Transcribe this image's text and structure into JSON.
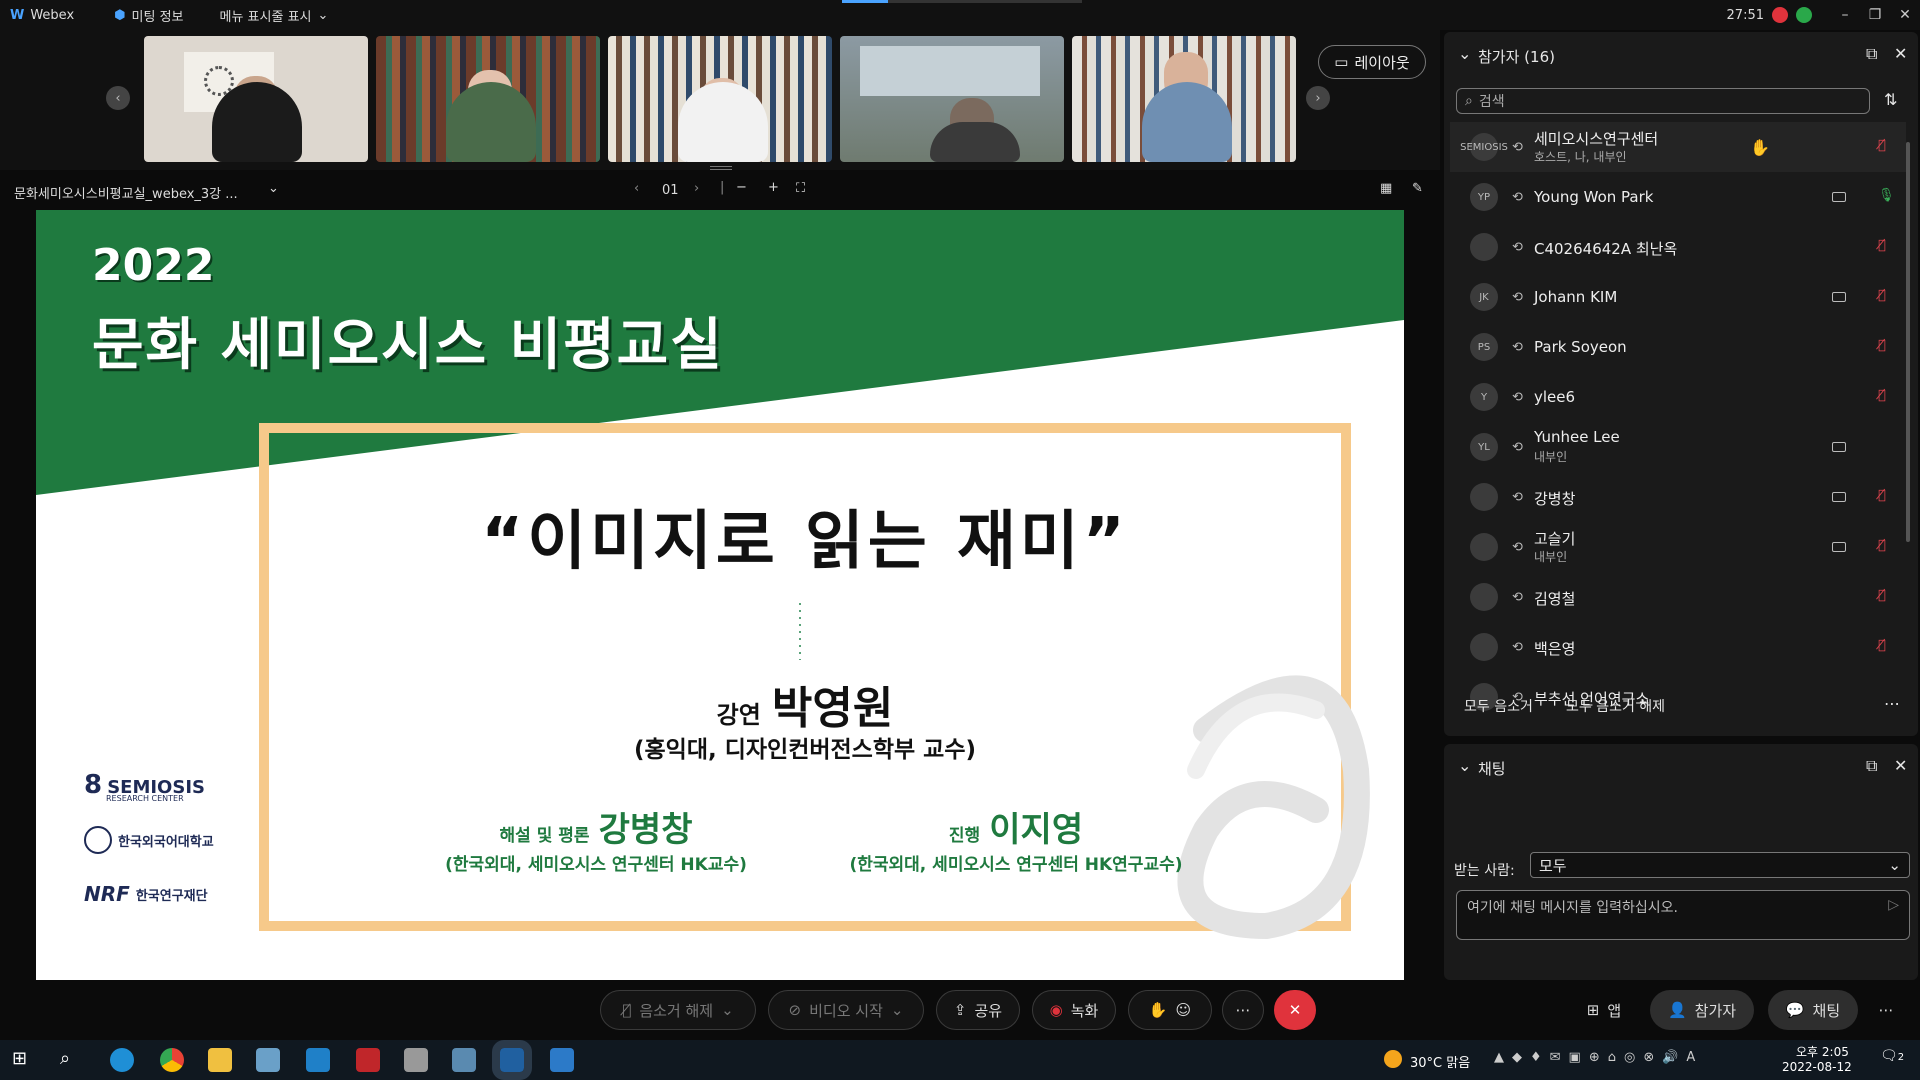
{
  "titlebar": {
    "app_name": "Webex",
    "meeting_info": "미팅 정보",
    "menu_toggle": "메뉴 표시줄 표시",
    "timer": "27:51"
  },
  "layout_button": "레이아웃",
  "share": {
    "filename": "문화세미오시스비평교실_webex_3강 ...",
    "page": "01"
  },
  "slide": {
    "year": "2022",
    "title": "문화 세미오시스 비평교실",
    "quote": "“이미지로 읽는 재미”",
    "lecture_label": "강연",
    "lecturer": "박영원",
    "lecturer_affil": "(홍익대, 디자인컨버전스학부 교수)",
    "commentary_label": "해설 및 평론",
    "commentator": "강병창",
    "commentator_affil": "(한국외대, 세미오시스 연구센터 HK교수)",
    "host_label": "진행",
    "host": "이지영",
    "host_affil": "(한국외대, 세미오시스 연구센터 HK연구교수)",
    "logos": {
      "semiosis": "SEMIOSIS",
      "semiosis_sub": "RESEARCH CENTER",
      "hufs": "한국외국어대학교",
      "nrf_mark": "NRF",
      "nrf": "한국연구재단"
    }
  },
  "controls": {
    "unmute": "음소거 해제",
    "start_video": "비디오 시작",
    "share": "공유",
    "record": "녹화",
    "apps": "앱",
    "participants": "참가자",
    "chat": "채팅"
  },
  "participants_panel": {
    "title": "참가자 (16)",
    "search_placeholder": "검색",
    "mute_all": "모두 음소거",
    "unmute_all": "모두 음소거 해제",
    "rows": [
      {
        "initials": "SEMIOSIS",
        "name": "세미오시스연구센터",
        "sub": "호스트, 나, 내부인",
        "icon": "hand",
        "mic": "muted"
      },
      {
        "initials": "YP",
        "name": "Young Won Park",
        "sub": "",
        "icon": "camera",
        "mic": "active"
      },
      {
        "initials": "",
        "name": "C40264642A 최난옥",
        "sub": "",
        "icon": "",
        "mic": "muted"
      },
      {
        "initials": "JK",
        "name": "Johann KIM",
        "sub": "",
        "icon": "camera",
        "mic": "muted"
      },
      {
        "initials": "PS",
        "name": "Park Soyeon",
        "sub": "",
        "icon": "",
        "mic": "muted"
      },
      {
        "initials": "Y",
        "name": "ylee6",
        "sub": "",
        "icon": "",
        "mic": "muted"
      },
      {
        "initials": "YL",
        "name": "Yunhee Lee",
        "sub": "내부인",
        "icon": "camera",
        "mic": ""
      },
      {
        "initials": "",
        "name": "강병창",
        "sub": "",
        "icon": "camera",
        "mic": "muted"
      },
      {
        "initials": "",
        "name": "고슬기",
        "sub": "내부인",
        "icon": "camera",
        "mic": "muted"
      },
      {
        "initials": "",
        "name": "김영철",
        "sub": "",
        "icon": "",
        "mic": "muted"
      },
      {
        "initials": "",
        "name": "백은영",
        "sub": "",
        "icon": "",
        "mic": "muted"
      },
      {
        "initials": "",
        "name": "부추선 언어연구소",
        "sub": "",
        "icon": "",
        "mic": ""
      }
    ]
  },
  "chat_panel": {
    "title": "채팅",
    "to_label": "받는 사람:",
    "to_value": "모두",
    "input_placeholder": "여기에 채팅 메시지를 입력하십시오."
  },
  "taskbar": {
    "weather": "30°C 맑음",
    "time": "오후 2:05",
    "date": "2022-08-12",
    "notifications": "2"
  },
  "colors": {
    "slide_green": "#1f7a3f",
    "frame_orange": "#f6c98a",
    "end_red": "#e0333c"
  }
}
